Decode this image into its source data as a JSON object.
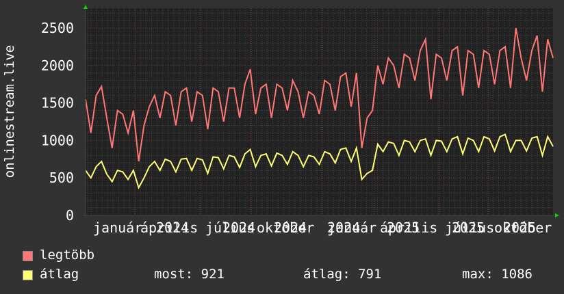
{
  "chart_data": {
    "type": "line",
    "ylabel": "onlinestream.live",
    "ylim": [
      0,
      2700
    ],
    "yticks": [
      "0",
      "500",
      "1000",
      "1500",
      "2000",
      "2500"
    ],
    "xtick_labels": [
      {
        "month": "január",
        "year": "2024"
      },
      {
        "month": "április",
        "year": "2024"
      },
      {
        "month": "július",
        "year": "2024"
      },
      {
        "month": "október",
        "year": "2024"
      },
      {
        "month": "január",
        "year": "2025"
      },
      {
        "month": "április",
        "year": "2025"
      },
      {
        "month": "július",
        "year": "2025"
      },
      {
        "month": "október",
        "year": "2025"
      }
    ],
    "grid": true,
    "series": [
      {
        "name": "legtöbb",
        "color": "#ff7777",
        "values": [
          1550,
          1100,
          1600,
          1720,
          1300,
          900,
          1400,
          1350,
          1100,
          1400,
          720,
          1200,
          1450,
          1600,
          1300,
          1650,
          1600,
          1200,
          1650,
          1700,
          1250,
          1650,
          1600,
          1150,
          1700,
          1650,
          1250,
          1700,
          1700,
          1300,
          1750,
          1950,
          1350,
          1700,
          1750,
          1300,
          1750,
          1700,
          1400,
          1800,
          1650,
          1300,
          1650,
          1600,
          1350,
          1800,
          1750,
          1400,
          1850,
          1900,
          1450,
          1900,
          900,
          1300,
          1400,
          2000,
          1750,
          2100,
          2000,
          1700,
          2150,
          2100,
          1800,
          2200,
          2350,
          1550,
          2150,
          2100,
          1800,
          2200,
          2250,
          1600,
          2200,
          2150,
          1700,
          2200,
          2150,
          1750,
          2200,
          2250,
          1700,
          2500,
          2100,
          1800,
          2200,
          2400,
          1650,
          2350,
          2100
        ]
      },
      {
        "name": "átlag",
        "color": "#ffff77",
        "values": [
          600,
          500,
          650,
          720,
          550,
          450,
          600,
          580,
          480,
          600,
          370,
          500,
          650,
          720,
          600,
          750,
          720,
          580,
          750,
          760,
          600,
          760,
          740,
          560,
          780,
          770,
          620,
          800,
          780,
          640,
          820,
          880,
          650,
          800,
          820,
          660,
          830,
          800,
          680,
          850,
          800,
          650,
          800,
          780,
          680,
          850,
          820,
          700,
          880,
          900,
          720,
          900,
          480,
          560,
          600,
          950,
          850,
          980,
          960,
          800,
          1000,
          980,
          850,
          1000,
          1020,
          800,
          1000,
          990,
          850,
          1020,
          1050,
          820,
          1030,
          1000,
          850,
          1050,
          1020,
          860,
          1050,
          1080,
          850,
          1000,
          1000,
          860,
          1030,
          1050,
          800,
          1050,
          920
        ]
      }
    ]
  },
  "legend": {
    "max_label": "legtöbb",
    "avg_label": "átlag",
    "now": "most: 921",
    "average": "átlag: 791",
    "maximum": "max: 1086"
  }
}
